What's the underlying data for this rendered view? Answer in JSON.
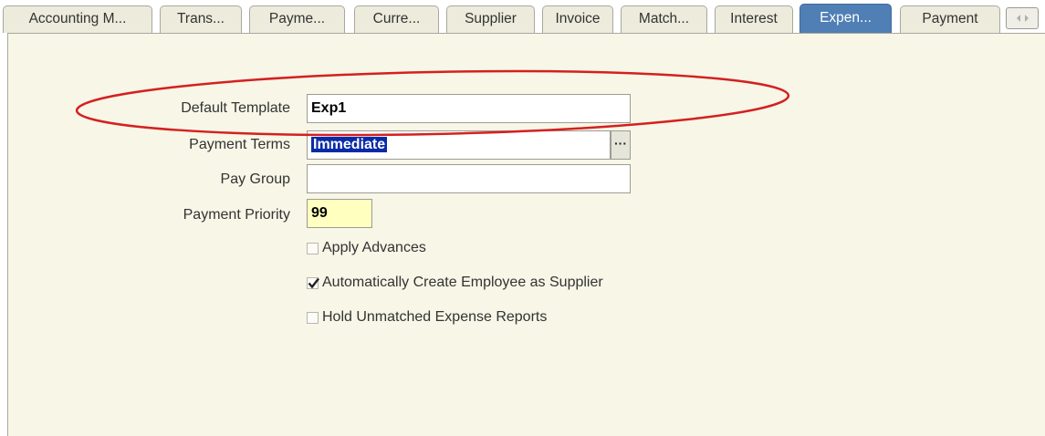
{
  "tabs": [
    {
      "label": "Accounting M...",
      "active": false
    },
    {
      "label": "Trans...",
      "active": false
    },
    {
      "label": "Payme...",
      "active": false
    },
    {
      "label": "Curre...",
      "active": false
    },
    {
      "label": "Supplier",
      "active": false
    },
    {
      "label": "Invoice",
      "active": false
    },
    {
      "label": "Match...",
      "active": false
    },
    {
      "label": "Interest",
      "active": false
    },
    {
      "label": "Expen...",
      "active": true
    },
    {
      "label": "Payment",
      "active": false
    }
  ],
  "form": {
    "default_template": {
      "label": "Default Template",
      "value": "Exp1"
    },
    "payment_terms": {
      "label": "Payment Terms",
      "value": "Immediate"
    },
    "pay_group": {
      "label": "Pay Group",
      "value": ""
    },
    "payment_priority": {
      "label": "Payment Priority",
      "value": "99"
    }
  },
  "checkboxes": {
    "apply_advances": {
      "label": "Apply Advances",
      "checked": false
    },
    "auto_create_supplier": {
      "label": "Automatically Create Employee as Supplier",
      "checked": true
    },
    "hold_unmatched": {
      "label": "Hold Unmatched Expense Reports",
      "checked": false
    }
  },
  "icons": {
    "lov": "ellipsis-icon",
    "tab_scroll": "tab-scroll-arrows-icon",
    "check": "checkmark-icon"
  },
  "colors": {
    "active_tab": "#4f7fb4",
    "panel_bg": "#f7f6e7",
    "required_field": "#ffffc0",
    "selection": "#0a2ba8",
    "annotation": "#d42020"
  }
}
